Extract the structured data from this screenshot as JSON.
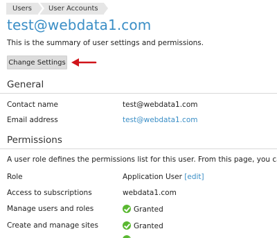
{
  "breadcrumb": [
    "Users",
    "User Accounts"
  ],
  "title": "test@webdata1.com",
  "summary": "This is the summary of user settings and permissions.",
  "change_settings_label": "Change Settings",
  "general": {
    "heading": "General",
    "rows": [
      {
        "label": "Contact name",
        "value": "test@webdata1.com"
      },
      {
        "label": "Email address",
        "value": "test@webdata1.com"
      }
    ]
  },
  "permissions": {
    "heading": "Permissions",
    "description": "A user role defines the permissions list for this user. From this page, you can edit th",
    "role": {
      "label": "Role",
      "value": "Application User",
      "edit": "[edit]"
    },
    "access": {
      "label": "Access to subscriptions",
      "value": "webdata1.com"
    },
    "manage_users": {
      "label": "Manage users and roles",
      "value": "Granted"
    },
    "create_sites": {
      "label": "Create and manage sites",
      "value": "Granted"
    }
  },
  "colors": {
    "accent": "#3a8ec6",
    "granted": "#5ab831",
    "arrow": "#d0141a"
  }
}
